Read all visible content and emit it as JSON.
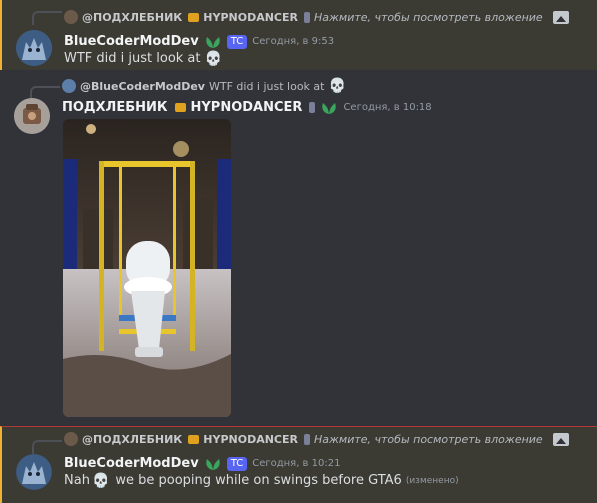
{
  "messages": [
    {
      "reply_name": "@ПОДХЛЕБНИК",
      "reply_name2": "HYPNODANCER",
      "reply_text": "Нажмите, чтобы посмотреть вложение",
      "username": "BlueCoderModDev",
      "tag": "TC",
      "time": "Сегодня, в 9:53",
      "text": "WTF did i just look at"
    },
    {
      "reply_name": "@BlueCoderModDev",
      "reply_text": "WTF did i just look at",
      "username": "ПОДХЛЕБНИК",
      "username2": "HYPNODANCER",
      "time": "Сегодня, в 10:18"
    },
    {
      "reply_name": "@ПОДХЛЕБНИК",
      "reply_name2": "HYPNODANCER",
      "reply_text": "Нажмите, чтобы посмотреть вложение",
      "username": "BlueCoderModDev",
      "tag": "TC",
      "time": "Сегодня, в 10:21",
      "text_before": "Nah",
      "text_after": "we be pooping while on swings before GTA6",
      "edited": "(изменено)"
    }
  ],
  "icons": {
    "skull": "skull-emoji",
    "image": "image-icon",
    "leaf": "nitro-leaf-icon"
  },
  "colors": {
    "background": "#313338",
    "highlight": "#3b3a33",
    "accent_bar": "#f0b232",
    "tag": "#5865f2",
    "leaf": "#3ba55d"
  }
}
